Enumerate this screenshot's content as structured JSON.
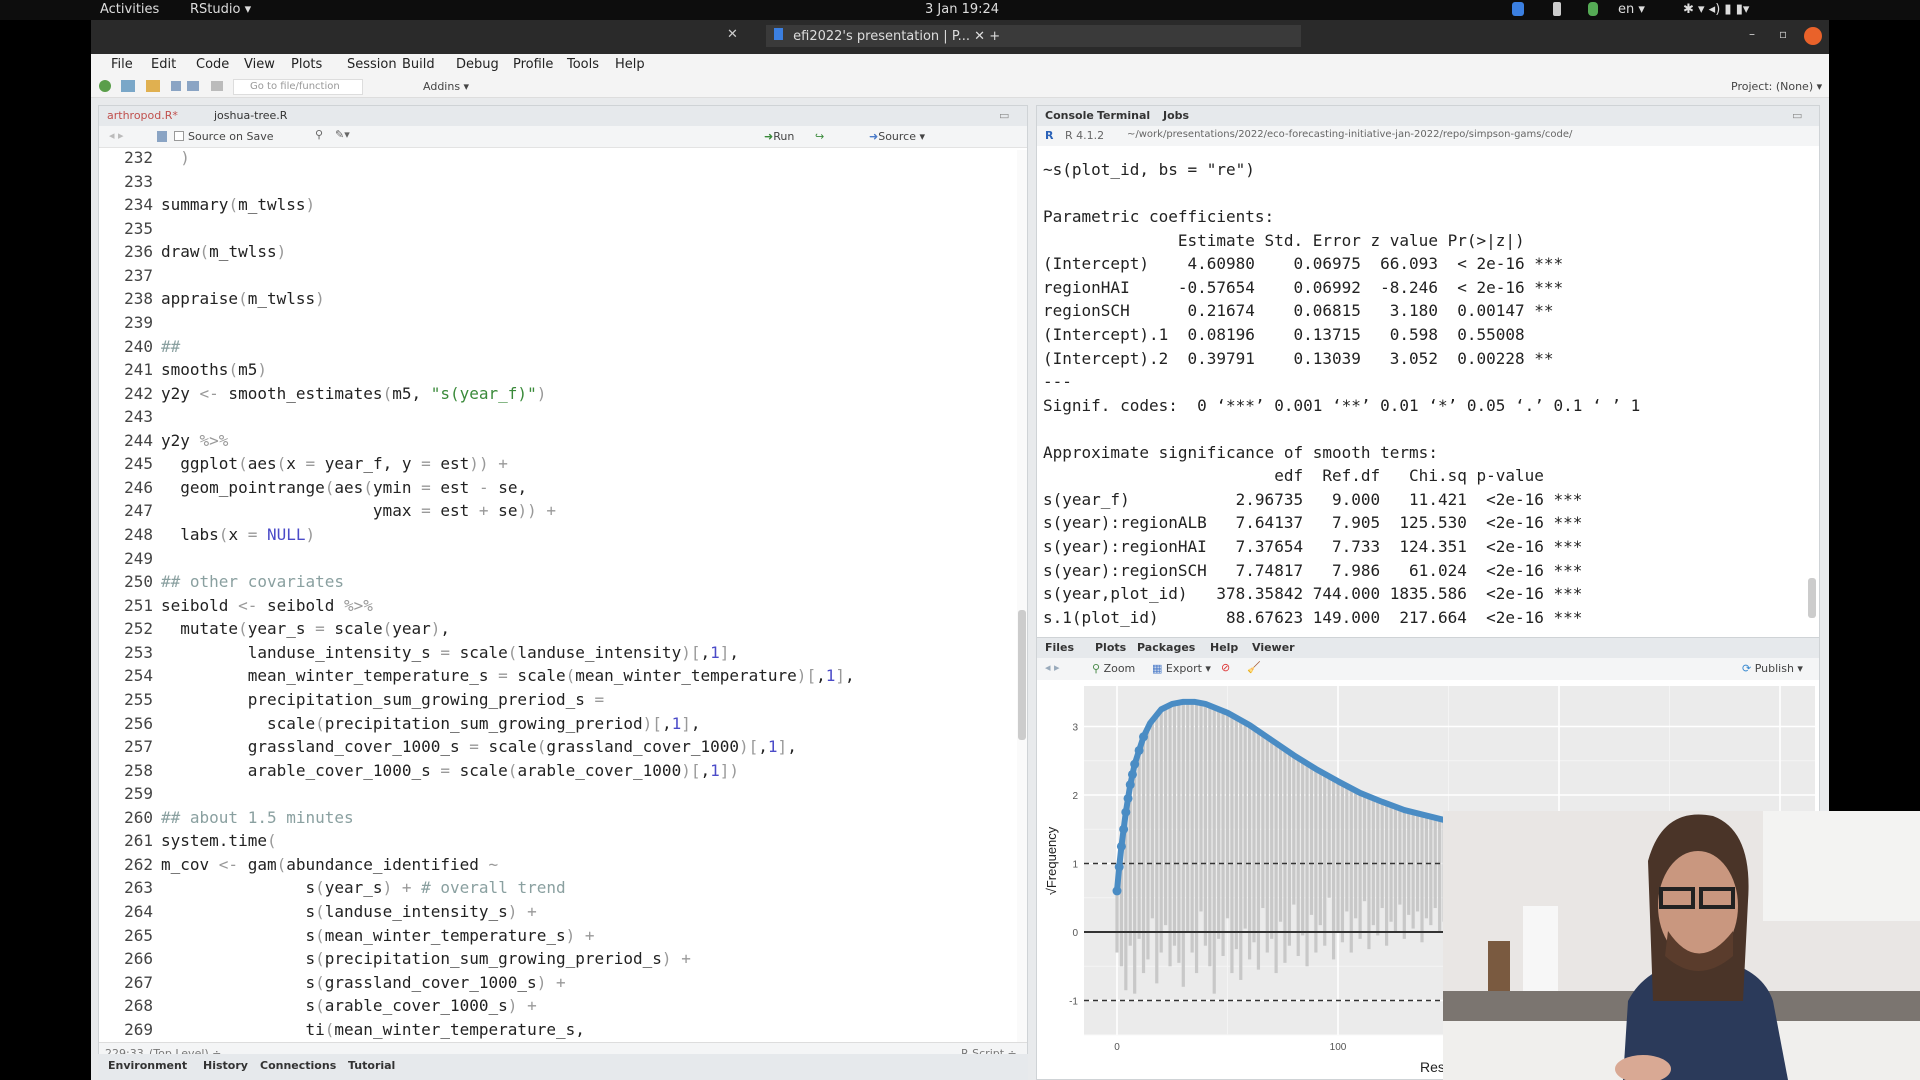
{
  "system_bar": {
    "activities": "Activities",
    "app_menu": "RStudio ▾",
    "clock": "3 Jan 19:24",
    "lang": "en ▾"
  },
  "browser_tab": {
    "title": "efi2022's presentation | P...",
    "close": "✕",
    "new": "+"
  },
  "menu": [
    "File",
    "Edit",
    "Code",
    "View",
    "Plots",
    "Session",
    "Build",
    "Debug",
    "Profile",
    "Tools",
    "Help"
  ],
  "toolbar": {
    "goto_placeholder": "Go to file/function",
    "addins": "Addins ▾",
    "project": "Project: (None) ▾"
  },
  "editor": {
    "tabs": [
      {
        "label": "arthropod.R*",
        "active": true
      },
      {
        "label": "joshua-tree.R",
        "active": false
      }
    ],
    "source_on_save": "Source on Save",
    "run": "Run",
    "source": "Source ▾",
    "first_line": 232,
    "lines": [
      "  )",
      "",
      "summary(m_twlss)",
      "",
      "draw(m_twlss)",
      "",
      "appraise(m_twlss)",
      "",
      "##",
      "smooths(m5)",
      "y2y <- smooth_estimates(m5, \"s(year_f)\")",
      "",
      "y2y %>%",
      "  ggplot(aes(x = year_f, y = est)) +",
      "  geom_pointrange(aes(ymin = est - se,",
      "                      ymax = est + se)) +",
      "  labs(x = NULL)",
      "",
      "## other covariates",
      "seibold <- seibold %>%",
      "  mutate(year_s = scale(year),",
      "         landuse_intensity_s = scale(landuse_intensity)[,1],",
      "         mean_winter_temperature_s = scale(mean_winter_temperature)[,1],",
      "         precipitation_sum_growing_preriod_s =",
      "           scale(precipitation_sum_growing_preriod)[,1],",
      "         grassland_cover_1000_s = scale(grassland_cover_1000)[,1],",
      "         arable_cover_1000_s = scale(arable_cover_1000)[,1])",
      "",
      "## about 1.5 minutes",
      "system.time(",
      "m_cov <- gam(abundance_identified ~",
      "               s(year_s) + # overall trend",
      "               s(landuse_intensity_s) +",
      "               s(mean_winter_temperature_s) +",
      "               s(precipitation_sum_growing_preriod_s) +",
      "               s(grassland_cover_1000_s) +",
      "               s(arable_cover_1000_s) +",
      "               ti(mean_winter_temperature_s,"
    ],
    "status": {
      "position": "229:33",
      "scope": "(Top Level) ÷",
      "filetype": "R Script ÷"
    }
  },
  "bottom_tabs": [
    "Environment",
    "History",
    "Connections",
    "Tutorial"
  ],
  "console": {
    "tabs": [
      "Console",
      "Terminal",
      "Jobs"
    ],
    "version": "R 4.1.2",
    "path": "~/work/presentations/2022/eco-forecasting-initiative-jan-2022/repo/simpson-gams/code/",
    "lines": [
      "~s(plot_id, bs = \"re\")",
      "",
      "Parametric coefficients:",
      "              Estimate Std. Error z value Pr(>|z|)",
      "(Intercept)    4.60980    0.06975  66.093  < 2e-16 ***",
      "regionHAI     -0.57654    0.06992  -8.246  < 2e-16 ***",
      "regionSCH      0.21674    0.06815   3.180  0.00147 **",
      "(Intercept).1  0.08196    0.13715   0.598  0.55008",
      "(Intercept).2  0.39791    0.13039   3.052  0.00228 **",
      "---",
      "Signif. codes:  0 ‘***’ 0.001 ‘**’ 0.01 ‘*’ 0.05 ‘.’ 0.1 ‘ ’ 1",
      "",
      "Approximate significance of smooth terms:",
      "                        edf  Ref.df   Chi.sq p-value",
      "s(year_f)           2.96735   9.000   11.421  <2e-16 ***",
      "s(year):regionALB   7.64137   7.905  125.530  <2e-16 ***",
      "s(year):regionHAI   7.37654   7.733  124.351  <2e-16 ***",
      "s(year):regionSCH   7.74817   7.986   61.024  <2e-16 ***",
      "s(year,plot_id)   378.35842 744.000 1835.586  <2e-16 ***",
      "s.1(plot_id)       88.67623 149.000  217.664  <2e-16 ***"
    ]
  },
  "plots_pane": {
    "tabs": [
      "Files",
      "Plots",
      "Packages",
      "Help",
      "Viewer"
    ],
    "zoom": "Zoom",
    "export": "Export ▾",
    "publish": "Publish ▾"
  },
  "chart_data": {
    "type": "rootogram",
    "ylabel": "√Frequency",
    "xlabel": "Res",
    "x_ticks": [
      0,
      100
    ],
    "y_ticks": [
      -1,
      0,
      1,
      2,
      3
    ],
    "reference_lines": [
      {
        "y": 1,
        "style": "dashed"
      },
      {
        "y": -1,
        "style": "dashed"
      },
      {
        "y": 0,
        "style": "solid"
      }
    ],
    "fitted": {
      "color": "#4a8cc4",
      "x": [
        0,
        1,
        2,
        3,
        4,
        5,
        6,
        7,
        8,
        10,
        12,
        15,
        20,
        25,
        30,
        35,
        40,
        50,
        60,
        70,
        80,
        90,
        100,
        110,
        120,
        130,
        140,
        150
      ],
      "y": [
        0.6,
        0.95,
        1.25,
        1.5,
        1.75,
        1.95,
        2.15,
        2.3,
        2.45,
        2.65,
        2.85,
        3.05,
        3.25,
        3.33,
        3.36,
        3.36,
        3.33,
        3.2,
        3.02,
        2.8,
        2.58,
        2.38,
        2.2,
        2.03,
        1.9,
        1.78,
        1.7,
        1.62
      ]
    },
    "bars": {
      "color": "#c8c8c8",
      "x_step": 2,
      "bottom": [
        -0.3,
        -0.5,
        -0.85,
        -0.2,
        -0.9,
        -0.1,
        -0.6,
        -0.4,
        0.2,
        -0.75,
        -0.3,
        0.1,
        -0.5,
        -0.2,
        -0.45,
        -0.8,
        0.0,
        -0.3,
        -0.6,
        0.3,
        -0.2,
        -0.5,
        -0.9,
        -0.1,
        -0.35,
        0.2,
        -0.6,
        -0.25,
        -0.7,
        0.05,
        -0.4,
        -0.15,
        -0.55,
        0.35,
        -0.3,
        -0.1,
        -0.6,
        0.15,
        -0.45,
        -0.2,
        0.4,
        -0.35,
        -0.05,
        -0.5,
        0.25,
        -0.3,
        0.1,
        -0.2,
        0.5,
        -0.4,
        0.0,
        -0.15,
        0.3,
        -0.3,
        0.2,
        -0.1,
        0.45,
        -0.25,
        0.1,
        -0.05,
        0.35,
        -0.2,
        0.15,
        0.0,
        0.4,
        -0.1,
        0.25,
        0.05,
        0.3,
        -0.15,
        0.2,
        0.1,
        0.35,
        0.0,
        0.15
      ]
    }
  }
}
